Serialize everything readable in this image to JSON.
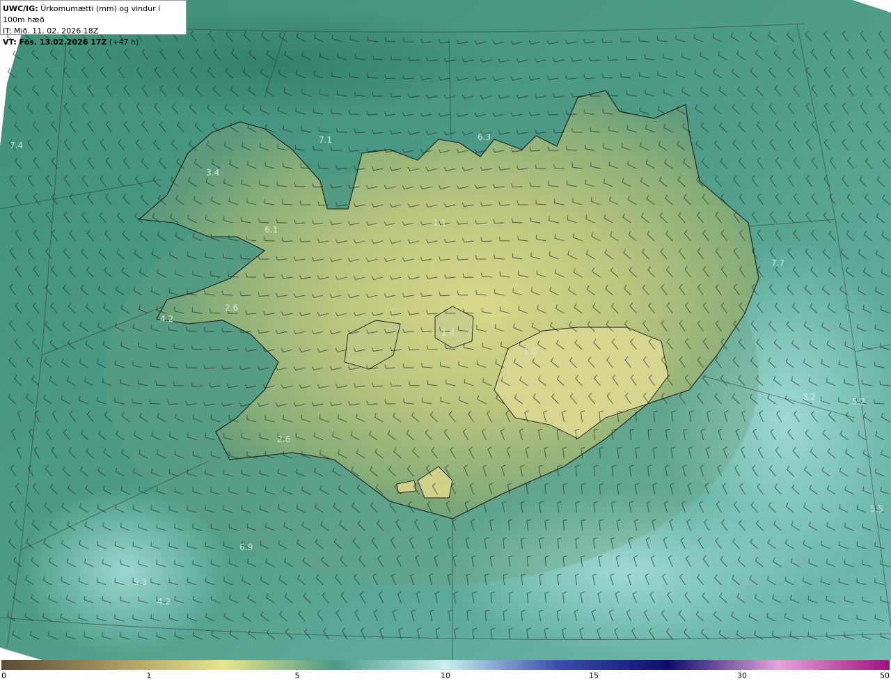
{
  "header": {
    "model": "UWC/IG:",
    "title": "Úrkomumætti (mm) og vindur í 100m hæð",
    "initial_time": "IT: Mið. 11. 02. 2026 18Z",
    "valid_label": "VT: Fös. 13.02.2026 17Z",
    "valid_offset": "(+47 h)"
  },
  "map_labels": [
    {
      "text": "7.4"
    },
    {
      "text": "7.1"
    },
    {
      "text": "6.3"
    },
    {
      "text": "3.4"
    },
    {
      "text": "6.1"
    },
    {
      "text": "1.1"
    },
    {
      "text": "7.7"
    },
    {
      "text": "2.6"
    },
    {
      "text": "4.2"
    },
    {
      "text": "1.4"
    },
    {
      "text": "1.0"
    },
    {
      "text": "8.2"
    },
    {
      "text": "5.2"
    },
    {
      "text": "2.6"
    },
    {
      "text": "5.5"
    },
    {
      "text": "6.9"
    },
    {
      "text": "5.3"
    },
    {
      "text": "4.2"
    }
  ],
  "colorbar": {
    "ticks": [
      "0",
      "1",
      "5",
      "10",
      "15",
      "30",
      "50"
    ],
    "colors": [
      "#5b4a36",
      "#a89560",
      "#e8e48a",
      "#4c9a86",
      "#c7f0ee",
      "#3c4fb0",
      "#0c0c6e",
      "#e9a3d8",
      "#a0107e"
    ]
  }
}
